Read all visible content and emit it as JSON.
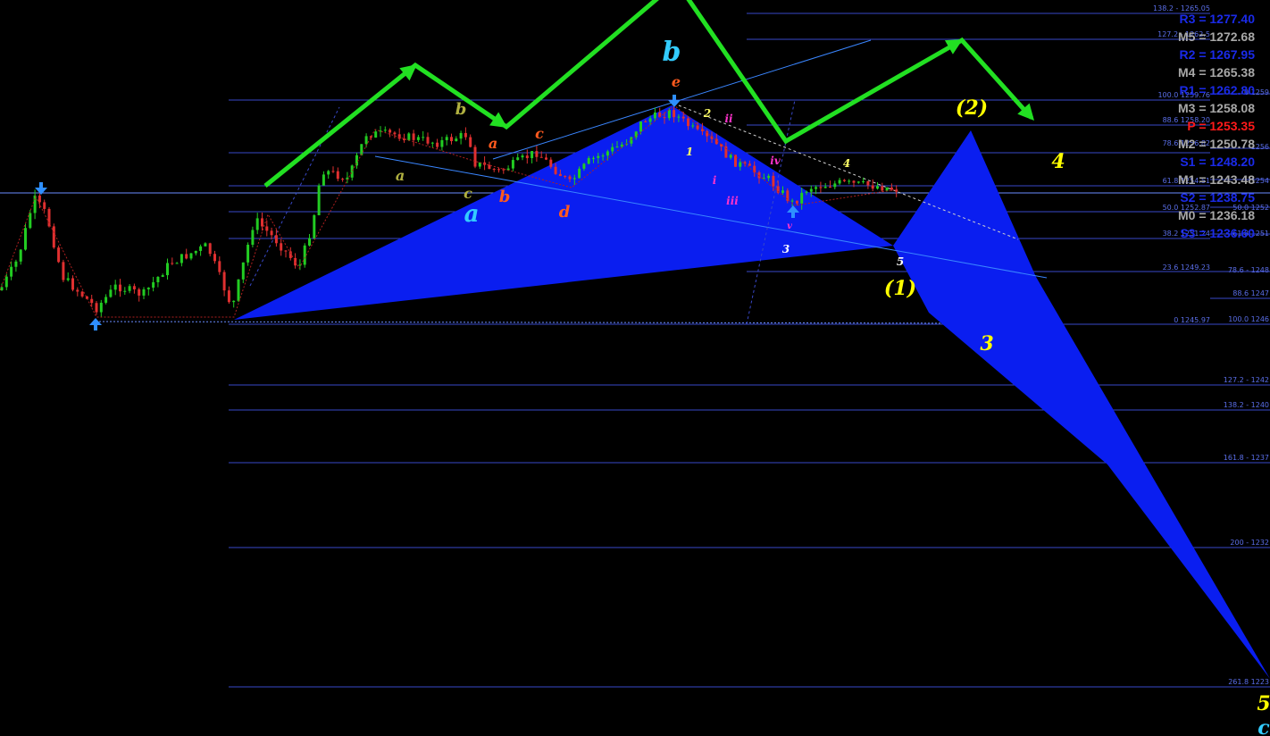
{
  "colors": {
    "background": "#000000",
    "bull_candle": "#22cc22",
    "bear_candle": "#e03030",
    "fib_line": "#3848c8",
    "pattern_fill": "#0a1ef0",
    "arrow_path": "#22e022",
    "trend_line": "#3a86ff",
    "pivot_blue": "#1a2ae8",
    "pivot_gray": "#a8a8a8",
    "pivot_red": "#ff1a1a"
  },
  "pivot_levels": [
    {
      "label": "R3 = 1277.40",
      "color": "blue"
    },
    {
      "label": "M5 = 1272.68",
      "color": "gray"
    },
    {
      "label": "R2 = 1267.95",
      "color": "blue"
    },
    {
      "label": "M4 = 1265.38",
      "color": "gray"
    },
    {
      "label": "R1 = 1262.80",
      "color": "blue"
    },
    {
      "label": "M3 = 1258.08",
      "color": "gray"
    },
    {
      "label": "P = 1253.35",
      "color": "red"
    },
    {
      "label": "M2 = 1250.78",
      "color": "gray"
    },
    {
      "label": "S1 = 1248.20",
      "color": "blue"
    },
    {
      "label": "M1 = 1243.48",
      "color": "gray"
    },
    {
      "label": "S2 = 1238.75",
      "color": "blue"
    },
    {
      "label": "M0 = 1236.18",
      "color": "gray"
    },
    {
      "label": "S3 = 1236.60",
      "color": "blue"
    }
  ],
  "fib_left": [
    {
      "label": "138.2 - 1265.05"
    },
    {
      "label": "127.2 - 1262.5"
    },
    {
      "label": "100.0 1259.76"
    },
    {
      "label": "88.6 1258.20"
    },
    {
      "label": "78.6 1256.82"
    },
    {
      "label": "61.8 1254.51"
    },
    {
      "label": "50.0 1252.87"
    },
    {
      "label": "38.2 1251.24"
    },
    {
      "label": "23.6 1249.23"
    },
    {
      "label": "0 1245.97"
    }
  ],
  "fib_right": [
    {
      "label": "0 1259"
    },
    {
      "label": "1256"
    },
    {
      "label": "1254"
    },
    {
      "label": "50.0 1252"
    },
    {
      "label": "61.8 1251"
    },
    {
      "label": "78.6 - 1248"
    },
    {
      "label": "88.6 1247"
    },
    {
      "label": "100.0 1246"
    },
    {
      "label": "127.2 - 1242"
    },
    {
      "label": "138.2 - 1240"
    },
    {
      "label": "161.8 - 1237"
    },
    {
      "label": "200 - 1232"
    },
    {
      "label": "261.8 1223"
    }
  ],
  "wave_labels": [
    {
      "text": "b",
      "color": "#33ccff",
      "size": 30,
      "name": "wave-b-major"
    },
    {
      "text": "a",
      "color": "#33ccff",
      "size": 26,
      "name": "wave-a-major"
    },
    {
      "text": "a",
      "color": "#b0b040",
      "size": 16,
      "name": "wave-a-olive"
    },
    {
      "text": "b",
      "color": "#b0b040",
      "size": 18,
      "name": "wave-b-olive"
    },
    {
      "text": "c",
      "color": "#b0b040",
      "size": 16,
      "name": "wave-c-olive"
    },
    {
      "text": "a",
      "color": "#ff5a1e",
      "size": 16,
      "name": "wave-a-orange"
    },
    {
      "text": "b",
      "color": "#ff5a1e",
      "size": 18,
      "name": "wave-b-orange"
    },
    {
      "text": "c",
      "color": "#ff5a1e",
      "size": 16,
      "name": "wave-c-orange"
    },
    {
      "text": "d",
      "color": "#ff5a1e",
      "size": 18,
      "name": "wave-d-orange"
    },
    {
      "text": "e",
      "color": "#ff5a1e",
      "size": 16,
      "name": "wave-e-orange"
    },
    {
      "text": "1",
      "color": "#ffff66",
      "size": 12,
      "name": "wave-1-small"
    },
    {
      "text": "2",
      "color": "#ffff66",
      "size": 12,
      "name": "wave-2-small"
    },
    {
      "text": "3",
      "color": "#ffffff",
      "size": 12,
      "name": "wave-3-small"
    },
    {
      "text": "4",
      "color": "#ffff66",
      "size": 12,
      "name": "wave-4-small"
    },
    {
      "text": "5",
      "color": "#ffffff",
      "size": 12,
      "name": "wave-5-small"
    },
    {
      "text": "i",
      "color": "#ff33cc",
      "size": 12,
      "name": "wave-i"
    },
    {
      "text": "ii",
      "color": "#ff33cc",
      "size": 12,
      "name": "wave-ii"
    },
    {
      "text": "iii",
      "color": "#ff33cc",
      "size": 12,
      "name": "wave-iii"
    },
    {
      "text": "iv",
      "color": "#ff33cc",
      "size": 12,
      "name": "wave-iv"
    },
    {
      "text": "v",
      "color": "#ff33cc",
      "size": 10,
      "name": "wave-v"
    },
    {
      "text": "(1)",
      "color": "#ffff00",
      "size": 22,
      "name": "wave-1-major"
    },
    {
      "text": "(2)",
      "color": "#ffff00",
      "size": 22,
      "name": "wave-2-major"
    },
    {
      "text": "3",
      "color": "#ffff00",
      "size": 22,
      "name": "wave-3-major"
    },
    {
      "text": "4",
      "color": "#ffff00",
      "size": 22,
      "name": "wave-4-major"
    },
    {
      "text": "5",
      "color": "#ffff00",
      "size": 22,
      "name": "wave-5-major"
    },
    {
      "text": "c",
      "color": "#33ccff",
      "size": 22,
      "name": "wave-c-major"
    }
  ],
  "chart_data": {
    "type": "candlestick",
    "title": "",
    "price_range": [
      1223,
      1277.4
    ],
    "grid": false,
    "candles_count": 190,
    "pivot_point": 1253.35,
    "fib_retracement_levels": [
      138.2,
      127.2,
      100.0,
      88.6,
      78.6,
      61.8,
      50.0,
      38.2,
      23.6,
      0
    ],
    "fib_projection_levels": [
      0,
      50.0,
      61.8,
      78.6,
      88.6,
      100.0,
      127.2,
      138.2,
      161.8,
      200,
      261.8
    ]
  }
}
